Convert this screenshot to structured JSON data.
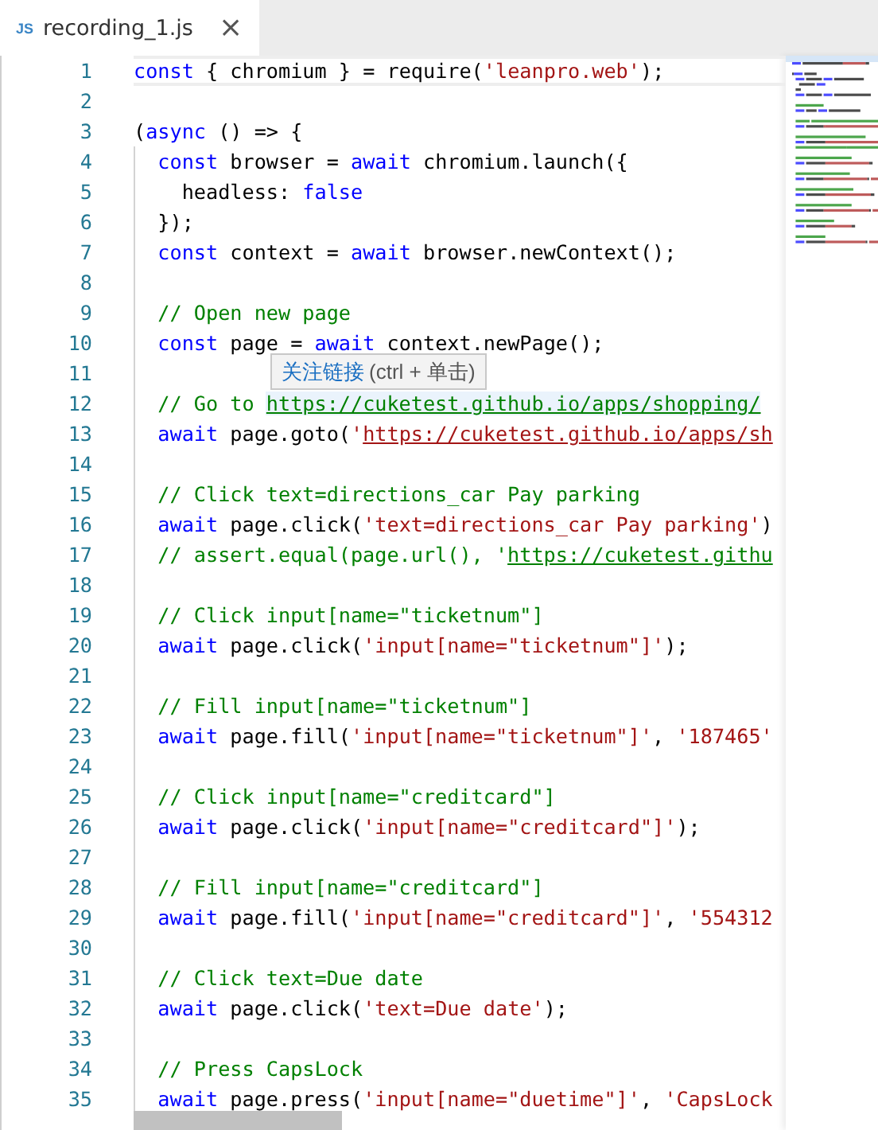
{
  "tab": {
    "icon_text": "JS",
    "title": "recording_1.js",
    "close": "×",
    "selected": true
  },
  "lines": [
    {
      "number": "1",
      "current": true,
      "tokens": [
        {
          "kind": "kw",
          "text": "const"
        },
        {
          "kind": "plain",
          "text": " { chromium } = require("
        },
        {
          "kind": "str",
          "text": "'leanpro.web'"
        },
        {
          "kind": "plain",
          "text": ");"
        }
      ]
    },
    {
      "number": "2"
    },
    {
      "number": "3",
      "tokens": [
        {
          "kind": "plain",
          "text": "("
        },
        {
          "kind": "kw",
          "text": "async"
        },
        {
          "kind": "plain",
          "text": " () => {"
        }
      ]
    },
    {
      "number": "4",
      "tokens": [
        {
          "kind": "kw",
          "text": "  const"
        },
        {
          "kind": "plain",
          "text": " browser = "
        },
        {
          "kind": "kw",
          "text": "await"
        },
        {
          "kind": "plain",
          "text": " chromium.launch({"
        }
      ]
    },
    {
      "number": "5",
      "tokens": [
        {
          "kind": "plain",
          "text": "    headless: "
        },
        {
          "kind": "kw",
          "text": "false"
        }
      ]
    },
    {
      "number": "6",
      "tokens": [
        {
          "kind": "plain",
          "text": "  });"
        }
      ]
    },
    {
      "number": "7",
      "tokens": [
        {
          "kind": "kw",
          "text": "  const"
        },
        {
          "kind": "plain",
          "text": " context = "
        },
        {
          "kind": "kw",
          "text": "await"
        },
        {
          "kind": "plain",
          "text": " browser.newContext();"
        }
      ]
    },
    {
      "number": "8"
    },
    {
      "number": "9",
      "tokens": [
        {
          "kind": "cmt",
          "text": "  // Open new page"
        }
      ]
    },
    {
      "number": "10",
      "tokens": [
        {
          "kind": "kw",
          "text": "  const"
        },
        {
          "kind": "plain",
          "text": " page = "
        },
        {
          "kind": "kw",
          "text": "await"
        },
        {
          "kind": "plain",
          "text": " context.newPage();"
        }
      ]
    },
    {
      "number": "11"
    },
    {
      "number": "12",
      "hovered": true,
      "tokens": [
        {
          "kind": "cmt",
          "text": "  // Go to "
        },
        {
          "kind": "link",
          "text": "https://cuketest.github.io/apps/shopping/"
        }
      ]
    },
    {
      "number": "13",
      "tokens": [
        {
          "kind": "kw",
          "text": "  await"
        },
        {
          "kind": "plain",
          "text": " page.goto("
        },
        {
          "kind": "str",
          "text": "'"
        },
        {
          "kind": "strlink",
          "text": "https://cuketest.github.io/apps/sh"
        }
      ]
    },
    {
      "number": "14"
    },
    {
      "number": "15",
      "tokens": [
        {
          "kind": "cmt",
          "text": "  // Click text=directions_car Pay parking"
        }
      ]
    },
    {
      "number": "16",
      "tokens": [
        {
          "kind": "kw",
          "text": "  await"
        },
        {
          "kind": "plain",
          "text": " page.click("
        },
        {
          "kind": "str",
          "text": "'text=directions_car Pay parking'"
        },
        {
          "kind": "plain",
          "text": ")"
        }
      ]
    },
    {
      "number": "17",
      "tokens": [
        {
          "kind": "cmt",
          "text": "  // assert.equal(page.url(), '"
        },
        {
          "kind": "link",
          "text": "https://cuketest.githu"
        }
      ]
    },
    {
      "number": "18"
    },
    {
      "number": "19",
      "tokens": [
        {
          "kind": "cmt",
          "text": "  // Click input[name=\"ticketnum\"]"
        }
      ]
    },
    {
      "number": "20",
      "tokens": [
        {
          "kind": "kw",
          "text": "  await"
        },
        {
          "kind": "plain",
          "text": " page.click("
        },
        {
          "kind": "str",
          "text": "'input[name=\"ticketnum\"]'"
        },
        {
          "kind": "plain",
          "text": ");"
        }
      ]
    },
    {
      "number": "21"
    },
    {
      "number": "22",
      "tokens": [
        {
          "kind": "cmt",
          "text": "  // Fill input[name=\"ticketnum\"]"
        }
      ]
    },
    {
      "number": "23",
      "tokens": [
        {
          "kind": "kw",
          "text": "  await"
        },
        {
          "kind": "plain",
          "text": " page.fill("
        },
        {
          "kind": "str",
          "text": "'input[name=\"ticketnum\"]'"
        },
        {
          "kind": "plain",
          "text": ", "
        },
        {
          "kind": "str",
          "text": "'187465'"
        }
      ]
    },
    {
      "number": "24"
    },
    {
      "number": "25",
      "tokens": [
        {
          "kind": "cmt",
          "text": "  // Click input[name=\"creditcard\"]"
        }
      ]
    },
    {
      "number": "26",
      "tokens": [
        {
          "kind": "kw",
          "text": "  await"
        },
        {
          "kind": "plain",
          "text": " page.click("
        },
        {
          "kind": "str",
          "text": "'input[name=\"creditcard\"]'"
        },
        {
          "kind": "plain",
          "text": ");"
        }
      ]
    },
    {
      "number": "27"
    },
    {
      "number": "28",
      "tokens": [
        {
          "kind": "cmt",
          "text": "  // Fill input[name=\"creditcard\"]"
        }
      ]
    },
    {
      "number": "29",
      "tokens": [
        {
          "kind": "kw",
          "text": "  await"
        },
        {
          "kind": "plain",
          "text": " page.fill("
        },
        {
          "kind": "str",
          "text": "'input[name=\"creditcard\"]'"
        },
        {
          "kind": "plain",
          "text": ", "
        },
        {
          "kind": "str",
          "text": "'554312"
        }
      ]
    },
    {
      "number": "30"
    },
    {
      "number": "31",
      "tokens": [
        {
          "kind": "cmt",
          "text": "  // Click text=Due date"
        }
      ]
    },
    {
      "number": "32",
      "tokens": [
        {
          "kind": "kw",
          "text": "  await"
        },
        {
          "kind": "plain",
          "text": " page.click("
        },
        {
          "kind": "str",
          "text": "'text=Due date'"
        },
        {
          "kind": "plain",
          "text": ");"
        }
      ]
    },
    {
      "number": "33"
    },
    {
      "number": "34",
      "tokens": [
        {
          "kind": "cmt",
          "text": "  // Press CapsLock"
        }
      ]
    },
    {
      "number": "35",
      "tokens": [
        {
          "kind": "kw",
          "text": "  await"
        },
        {
          "kind": "plain",
          "text": " page.press("
        },
        {
          "kind": "str",
          "text": "'input[name=\"duetime\"]'"
        },
        {
          "kind": "plain",
          "text": ", "
        },
        {
          "kind": "str",
          "text": "'CapsLock"
        }
      ]
    }
  ],
  "tooltip": {
    "link_label": "关注链接",
    "hint": "(ctrl + 单击)"
  }
}
